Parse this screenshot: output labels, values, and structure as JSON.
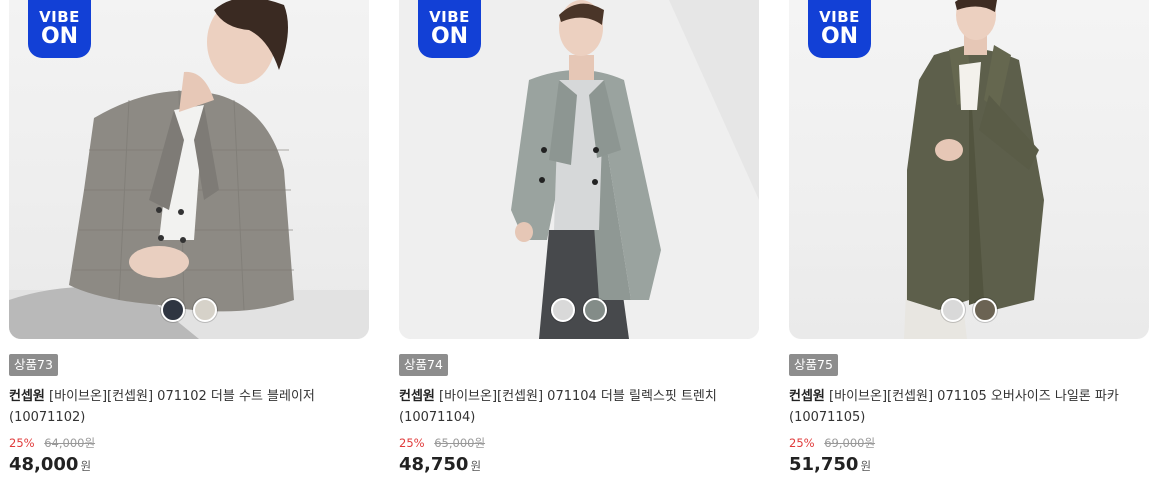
{
  "products": [
    {
      "badge_line1": "VIBE",
      "badge_line2": "ON",
      "tag": "상품73",
      "brand": "컨셉원",
      "name": "[바이브온][컨셉원] 071102 더블 수트 블레이저",
      "code": "(10071102)",
      "discount": "25%",
      "original_price": "64,000원",
      "price": "48,000",
      "currency": "원",
      "swatch_colors": [
        "#2f3541",
        "#d6d2c9"
      ]
    },
    {
      "badge_line1": "VIBE",
      "badge_line2": "ON",
      "tag": "상품74",
      "brand": "컨셉원",
      "name": "[바이브온][컨셉원] 071104 더블 릴렉스핏 트렌치",
      "code": "(10071104)",
      "discount": "25%",
      "original_price": "65,000원",
      "price": "48,750",
      "currency": "원",
      "swatch_colors": [
        "#d9d9d9",
        "#838c88"
      ]
    },
    {
      "badge_line1": "VIBE",
      "badge_line2": "ON",
      "tag": "상품75",
      "brand": "컨셉원",
      "name": "[바이브온][컨셉원] 071105 오버사이즈 나일론 파카",
      "code": "(10071105)",
      "discount": "25%",
      "original_price": "69,000원",
      "price": "51,750",
      "currency": "원",
      "swatch_colors": [
        "#d9d9d9",
        "#6b6353"
      ]
    }
  ],
  "colors": {
    "badge_blue": "#1240d6",
    "discount_red": "#e03b3b",
    "tag_gray": "#8d8d8d"
  }
}
